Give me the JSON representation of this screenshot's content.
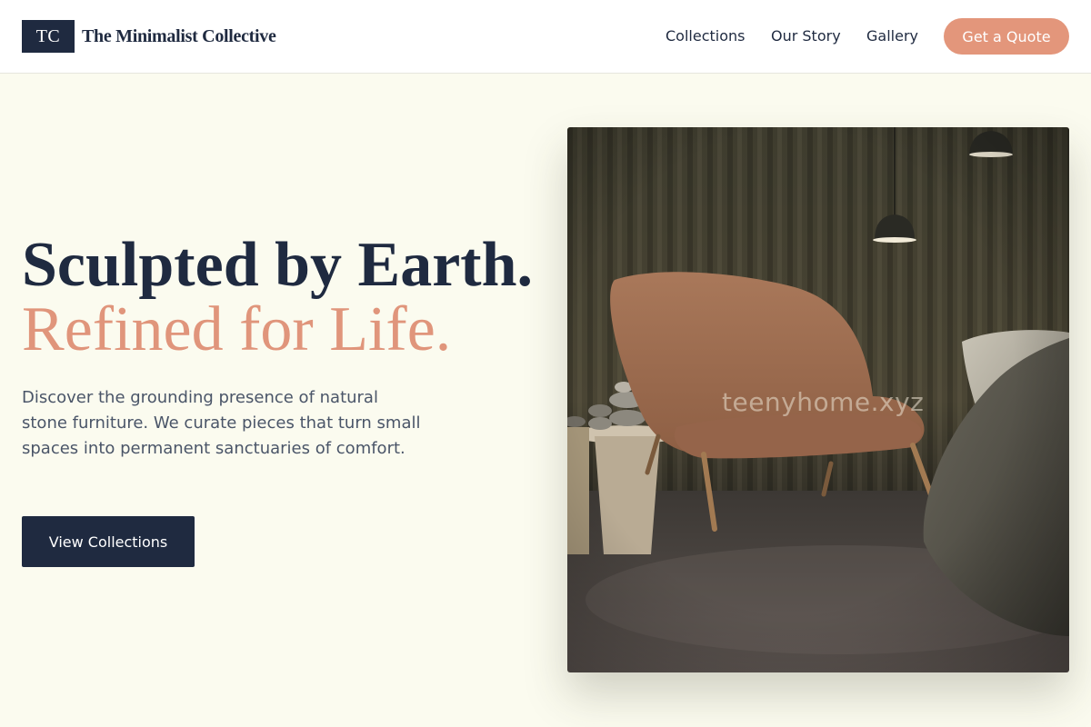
{
  "brand": {
    "mark": "TC",
    "name": "The Minimalist Collective"
  },
  "nav": {
    "items": [
      {
        "label": "Collections"
      },
      {
        "label": "Our Story"
      },
      {
        "label": "Gallery"
      }
    ],
    "cta_label": "Get a Quote"
  },
  "hero": {
    "headline_line1": "Sculpted by Earth.",
    "headline_line2": "Refined for Life.",
    "description": "Discover the grounding presence of natural stone furniture. We curate pieces that turn small spaces into permanent sanctuaries of comfort.",
    "button_label": "View Collections",
    "image_watermark": "teenyhome.xyz"
  },
  "colors": {
    "primary_navy": "#1F2A40",
    "accent_terracotta": "#E3967B",
    "page_background": "#FBFBEF",
    "body_text": "#4A5568"
  },
  "icons": {
    "logo": "tc-monogram"
  }
}
